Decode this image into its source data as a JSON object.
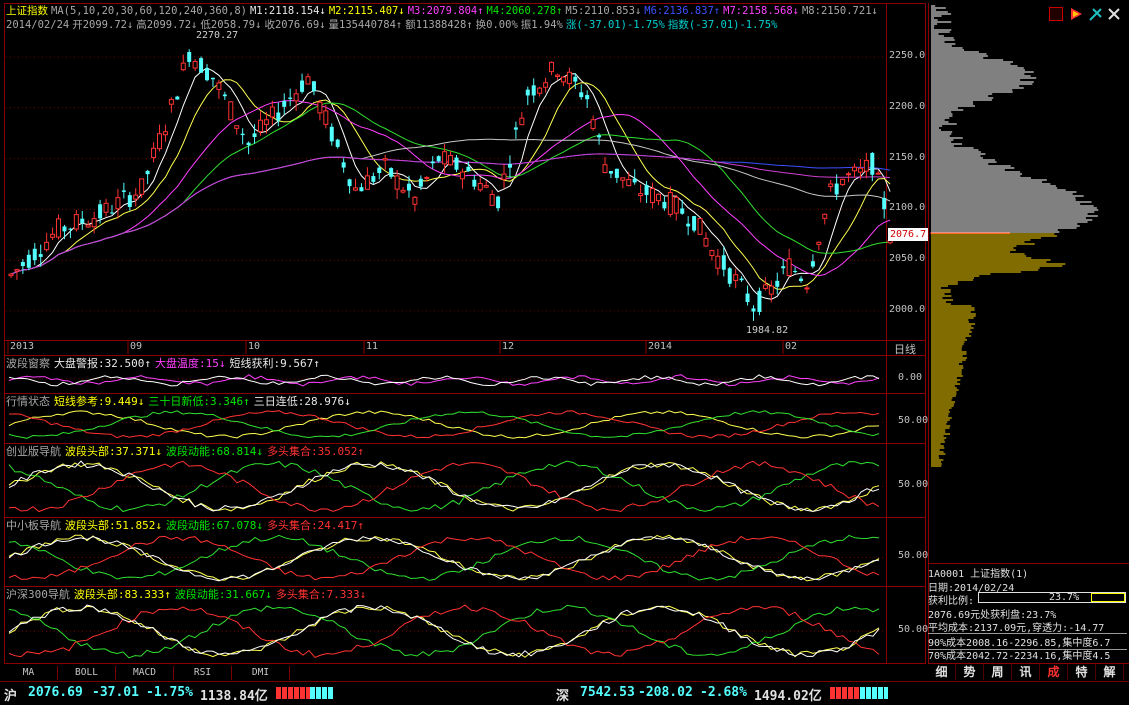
{
  "header": {
    "line1": [
      {
        "t": "上证指数",
        "c": "y"
      },
      {
        "t": "MA(5,10,20,30,60,120,240,360,8)",
        "c": "gr"
      },
      {
        "t": "M1:2118.154↓",
        "c": "w"
      },
      {
        "t": "M2:2115.407↓",
        "c": "y"
      },
      {
        "t": "M3:2079.804↑",
        "c": "m"
      },
      {
        "t": "M4:2060.278↑",
        "c": "g"
      },
      {
        "t": "M5:2110.853↓",
        "c": "gr"
      },
      {
        "t": "M6:2136.837↑",
        "c": "b"
      },
      {
        "t": "M7:2158.568↓",
        "c": "m"
      },
      {
        "t": "M8:2150.721↓",
        "c": "gr"
      }
    ],
    "line2": [
      {
        "t": "2014/02/24",
        "c": "gr"
      },
      {
        "t": "开2099.72↓",
        "c": "gr"
      },
      {
        "t": "高2099.72↓",
        "c": "gr"
      },
      {
        "t": "低2058.79↓",
        "c": "gr"
      },
      {
        "t": "收2076.69↓",
        "c": "gr"
      },
      {
        "t": "量135440784↑",
        "c": "gr"
      },
      {
        "t": "额11388428↑",
        "c": "gr"
      },
      {
        "t": "换0.00%",
        "c": "gr"
      },
      {
        "t": "振1.94%",
        "c": "gr"
      },
      {
        "t": "涨(-37.01)-1.75%",
        "c": "c"
      },
      {
        "t": "指数(-37.01)-1.75%",
        "c": "c"
      }
    ]
  },
  "main_chart": {
    "y_ticks": [
      "2250.0",
      "2200.0",
      "2150.0",
      "2100.0",
      "2050.0",
      "2000.0"
    ],
    "x_labels": [
      "2013",
      "09",
      "10",
      "11",
      "12",
      "2014",
      "02"
    ],
    "x_unit": "日线",
    "current_price_tag": "2076.7",
    "high_marker": "2270.27",
    "low_marker": "1984.82"
  },
  "panels": [
    {
      "title": [
        {
          "t": "波段窗察",
          "c": "gr"
        },
        {
          "t": "大盘警报:32.500↑",
          "c": "w"
        },
        {
          "t": "大盘温度:15↓",
          "c": "m"
        },
        {
          "t": "短线获利:9.567↑",
          "c": "w"
        }
      ],
      "tick": "0.00"
    },
    {
      "title": [
        {
          "t": "行情状态",
          "c": "gr"
        },
        {
          "t": "短线参考:9.449↓",
          "c": "y"
        },
        {
          "t": "三十日新低:3.346↑",
          "c": "g"
        },
        {
          "t": "三日连低:28.976↓",
          "c": "w"
        }
      ],
      "tick": "50.00"
    },
    {
      "title": [
        {
          "t": "创业版导航",
          "c": "gr"
        },
        {
          "t": "波段头部:37.371↓",
          "c": "y"
        },
        {
          "t": "波段动能:68.814↓",
          "c": "g"
        },
        {
          "t": "多头集合:35.052↑",
          "c": "r"
        }
      ],
      "tick": "50.00"
    },
    {
      "title": [
        {
          "t": "中小板导航",
          "c": "gr"
        },
        {
          "t": "波段头部:51.852↓",
          "c": "y"
        },
        {
          "t": "波段动能:67.078↓",
          "c": "g"
        },
        {
          "t": "多头集合:24.417↑",
          "c": "r"
        }
      ],
      "tick": "50.00"
    },
    {
      "title": [
        {
          "t": "沪深300导航",
          "c": "gr"
        },
        {
          "t": "波段头部:83.333↑",
          "c": "y"
        },
        {
          "t": "波段动能:31.667↓",
          "c": "g"
        },
        {
          "t": "多头集合:7.333↓",
          "c": "r"
        }
      ],
      "tick": "50.00"
    }
  ],
  "tabs": [
    "MA",
    "BOLL",
    "MACD",
    "RSI",
    "DMI"
  ],
  "sidebar": {
    "code_line": "1A0001 上证指数(1)",
    "date_line": "日期:2014/02/24",
    "profit_label": "获利比例:",
    "profit_value": "23.7%",
    "profit_fraction": 0.237,
    "line_a": "2076.69元处获利盘:23.7%",
    "line_b": "平均成本:2137.09元,穿透力:-14.77",
    "line_c": "90%成本2008.16-2296.85,集中度6.7",
    "line_d": "70%成本2042.72-2234.16,集中度4.5",
    "bottom_tabs": [
      "细",
      "势",
      "周",
      "讯",
      "成",
      "特",
      "解"
    ]
  },
  "statusbar": {
    "sh_label": "沪",
    "sh_price": "2076.69",
    "sh_change": "-37.01",
    "sh_pct": "-1.75%",
    "sh_amount": "1138.84亿",
    "sz_label": "深",
    "sz_price": "7542.53",
    "sz_change": "-208.02",
    "sz_pct": "-2.68%",
    "sz_amount": "1494.02亿"
  },
  "colors": {
    "frame": "#8b0000",
    "up": "#ff3232",
    "down": "#54ffff",
    "price_tag_bg": "#ffffff"
  }
}
